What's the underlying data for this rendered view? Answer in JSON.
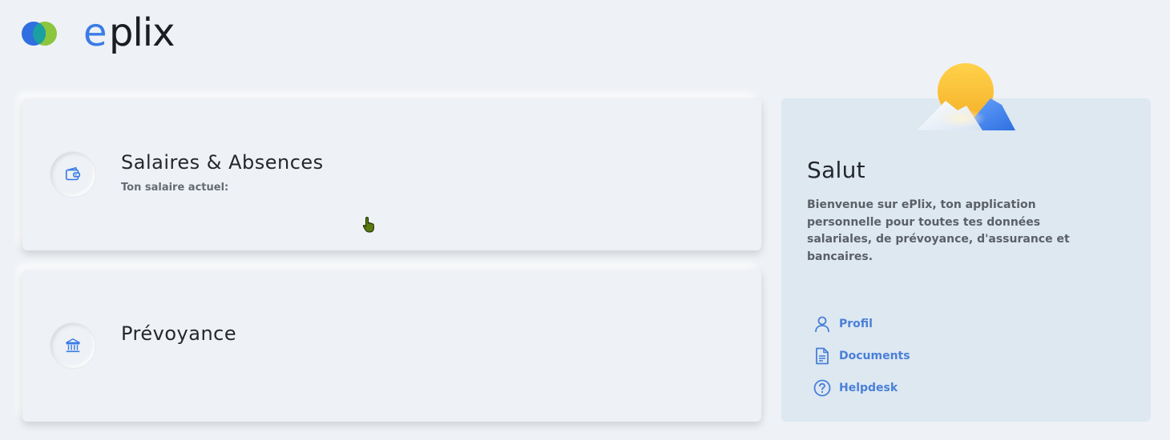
{
  "brand": {
    "name": "eplix",
    "colors": {
      "blue": "#3b7ce6",
      "green": "#8cc63f",
      "text": "#1b1d21"
    }
  },
  "cards": [
    {
      "title": "Salaires & Absences",
      "subtitle": "Ton salaire actuel:",
      "icon": "wallet-icon"
    },
    {
      "title": "Prévoyance",
      "subtitle": "",
      "icon": "bank-icon"
    }
  ],
  "panel": {
    "greeting": "Salut",
    "welcome": "Bienvenue sur ePlix, ton application personnelle pour toutes tes données salariales, de prévoyance, d'assurance et bancaires.",
    "links": [
      {
        "label": "Profil",
        "icon": "user-icon"
      },
      {
        "label": "Documents",
        "icon": "document-icon"
      },
      {
        "label": "Helpdesk",
        "icon": "help-icon"
      }
    ],
    "illustration": "sun-mountains-icon"
  },
  "colors": {
    "accent": "#4a7fd8",
    "background": "#eef1f5",
    "panel": "#dde8f1"
  }
}
